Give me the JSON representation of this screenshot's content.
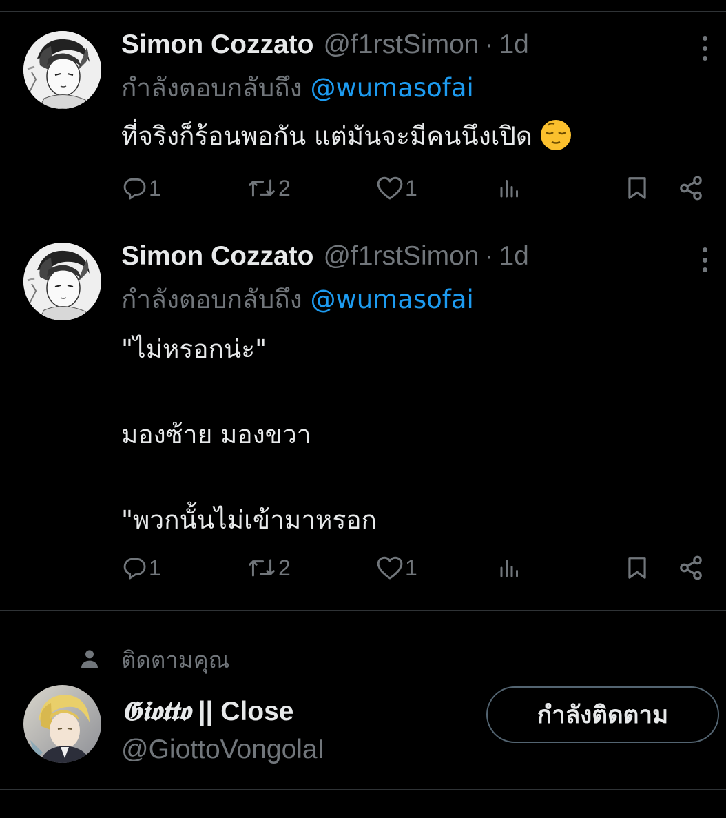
{
  "tweets": [
    {
      "display_name": "Simon Cozzato",
      "handle": "@f1rstSimon",
      "dot": "·",
      "time": "1d",
      "reply_prefix": "กำลังตอบกลับถึง",
      "reply_to": "@wumasofai",
      "text": "ที่จริงก็ร้อนพอกัน แต่มันจะมีคนนึงเปิด",
      "emoji": "relieved-face",
      "replies": "1",
      "retweets": "2",
      "likes": "1"
    },
    {
      "display_name": "Simon Cozzato",
      "handle": "@f1rstSimon",
      "dot": "·",
      "time": "1d",
      "reply_prefix": "กำลังตอบกลับถึง",
      "reply_to": "@wumasofai",
      "text": "\"ไม่หรอกน่ะ\"\n\nมองซ้าย มองขวา\n\n\"พวกนั้นไม่เข้ามาหรอก",
      "replies": "1",
      "retweets": "2",
      "likes": "1"
    }
  ],
  "follow_suggestion": {
    "label": "ติดตามคุณ",
    "name_stylized": "𝕲𝖎𝖔𝖙𝖙𝖔",
    "name_rest": " || Close",
    "handle": "@GiottoVongolaI",
    "button_label": "กำลังติดตาม"
  },
  "icons": [
    "more-icon",
    "reply-icon",
    "retweet-icon",
    "like-icon",
    "views-icon",
    "bookmark-icon",
    "share-icon",
    "person-icon"
  ],
  "colors": {
    "background": "#000000",
    "text": "#e7e9ea",
    "secondary": "#71767b",
    "mention": "#1d9bf0",
    "divider": "#2f3336"
  }
}
